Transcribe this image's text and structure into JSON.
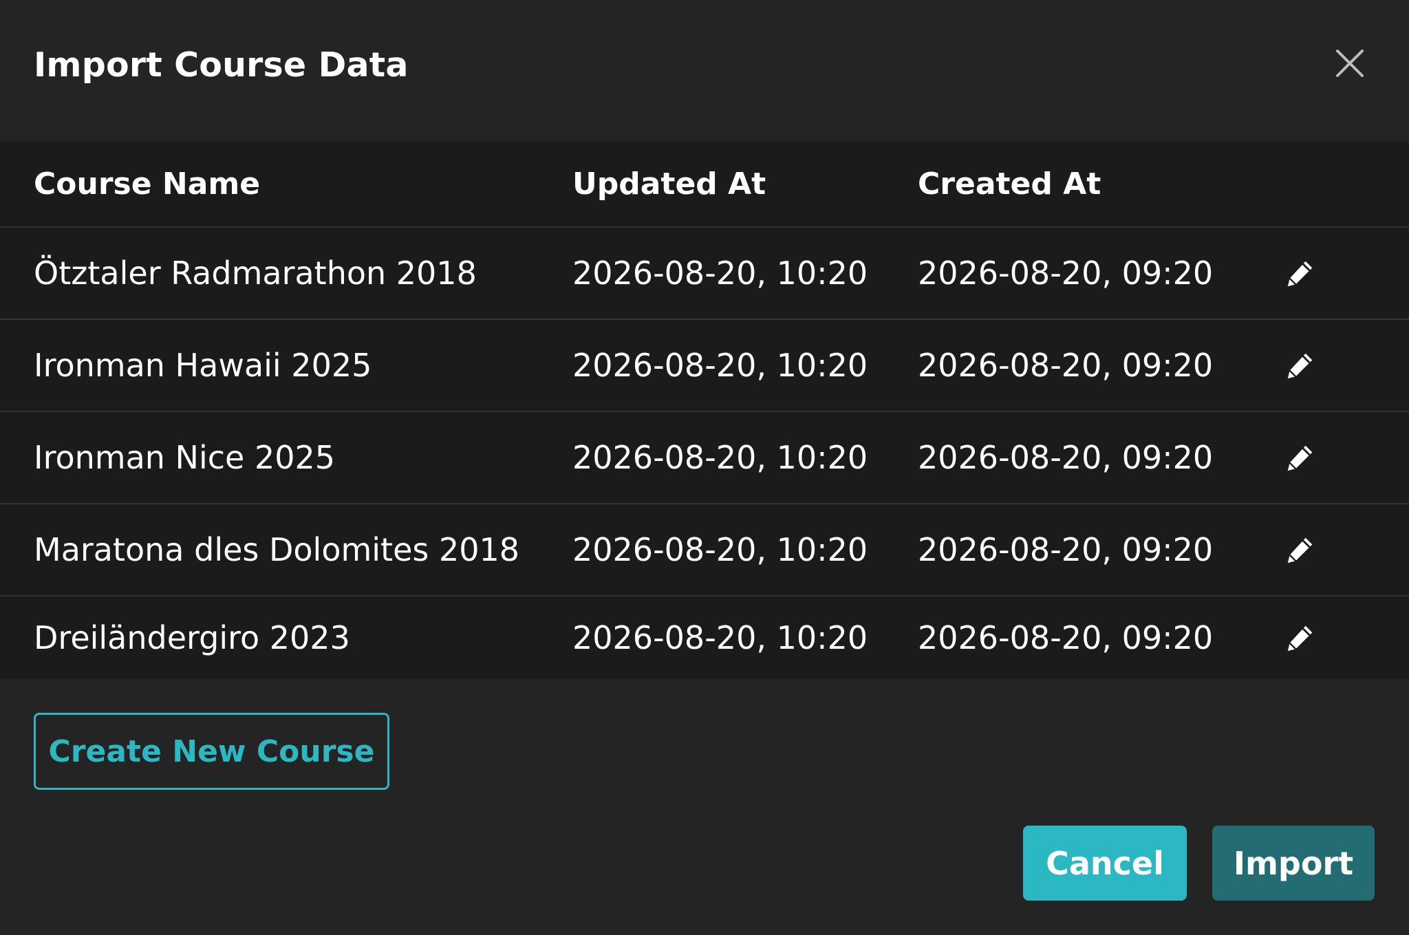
{
  "dialog": {
    "title": "Import Course Data",
    "close_icon": "close-icon"
  },
  "table": {
    "headers": [
      "Course Name",
      "Updated At",
      "Created At"
    ],
    "rows": [
      {
        "name": "Ötztaler Radmarathon 2018",
        "updated": "2026-08-20, 10:20",
        "created": "2026-08-20, 09:20",
        "action_icon": "pencil-icon"
      },
      {
        "name": "Ironman Hawaii 2025",
        "updated": "2026-08-20, 10:20",
        "created": "2026-08-20, 09:20",
        "action_icon": "pencil-icon"
      },
      {
        "name": "Ironman Nice 2025",
        "updated": "2026-08-20, 10:20",
        "created": "2026-08-20, 09:20",
        "action_icon": "pencil-icon"
      },
      {
        "name": "Maratona dles Dolomites 2018",
        "updated": "2026-08-20, 10:20",
        "created": "2026-08-20, 09:20",
        "action_icon": "pencil-icon"
      },
      {
        "name": "Dreiländergiro 2023",
        "updated": "2026-08-20, 10:20",
        "created": "2026-08-20, 09:20",
        "action_icon": "pencil-icon"
      }
    ]
  },
  "actions": {
    "create_label": "Create New Course",
    "cancel_label": "Cancel",
    "import_label": "Import"
  },
  "colors": {
    "background": "#242424",
    "table_background": "#1b1b1b",
    "accent": "#2cb8c3",
    "import_button": "#236d72"
  }
}
